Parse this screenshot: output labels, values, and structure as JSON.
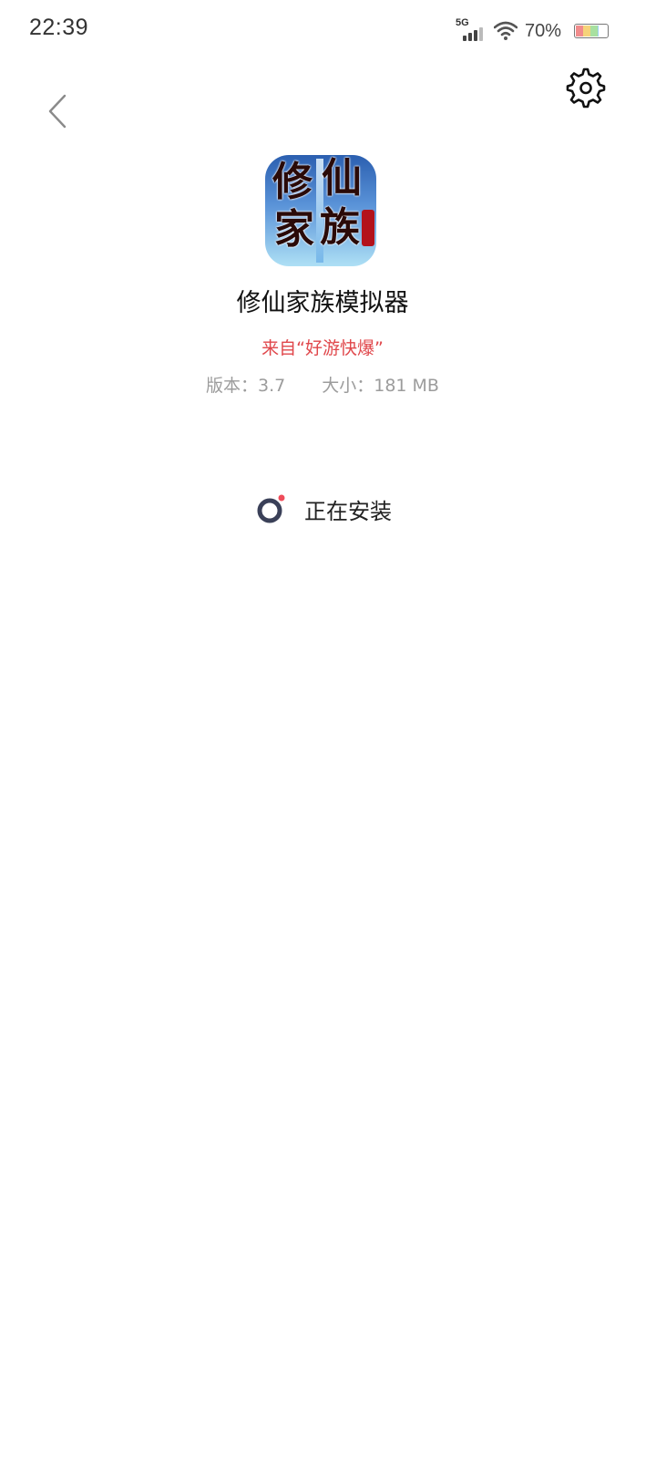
{
  "status_bar": {
    "time": "22:39",
    "network": "5G",
    "battery_percent": "70%",
    "signal_level": 0.75,
    "wifi_icon": "wifi-icon",
    "battery_icon": "battery-icon"
  },
  "header": {
    "back_icon": "chevron-left-icon",
    "settings_icon": "gear-icon"
  },
  "app": {
    "icon": "app-icon",
    "icon_text": [
      "修",
      "仙",
      "家",
      "族"
    ],
    "name": "修仙家族模拟器",
    "source": "来自“好游快爆”",
    "version": "版本：3.7",
    "size": "大小：181 MB"
  },
  "install": {
    "status_label": "正在安装",
    "spinner_icon": "loading-spinner-icon"
  },
  "colors": {
    "accent_red": "#e0474b",
    "meta_gray": "#9c9c9c",
    "spinner_ring": "#3a4058",
    "spinner_dot": "#ef4c5a"
  }
}
